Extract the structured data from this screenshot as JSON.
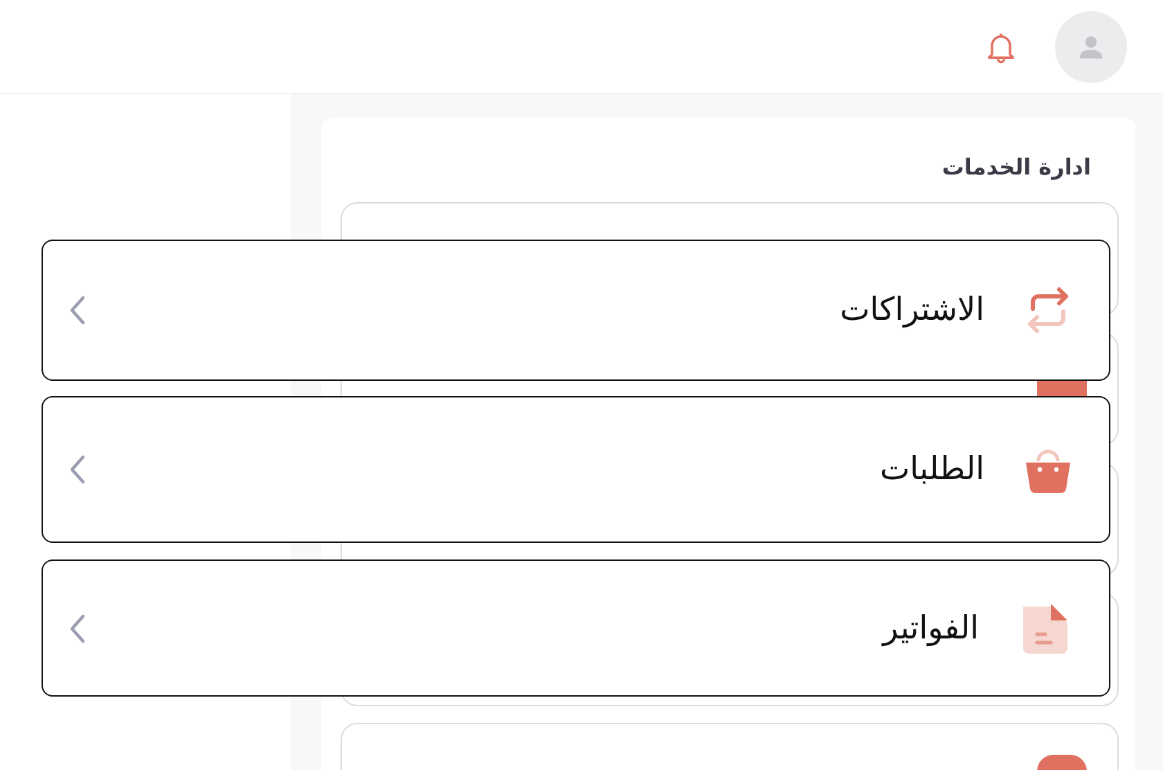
{
  "section": {
    "title": "ادارة الخدمات"
  },
  "items": [
    {
      "label": "الاشتراكات",
      "kind": "repeat"
    },
    {
      "label": "الطلبات",
      "kind": "bag"
    },
    {
      "label": "الفواتير",
      "kind": "invoice"
    }
  ]
}
